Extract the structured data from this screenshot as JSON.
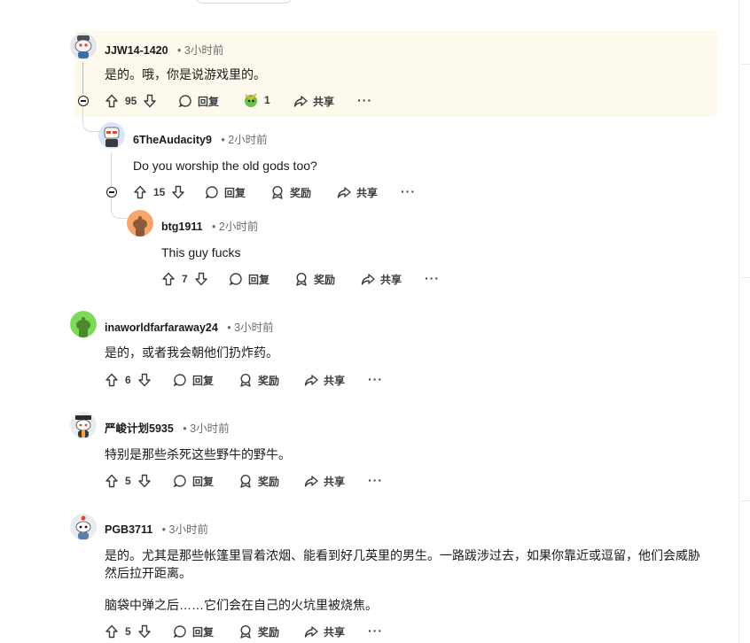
{
  "comments": [
    {
      "author": "JJW14-1420",
      "time": "• 3小时前",
      "text": "是的。哦，你是说游戏里的。",
      "votes": "95",
      "reply_label": "回复",
      "award_count": "1",
      "share_label": "共享",
      "more_label": "···"
    },
    {
      "author": "6TheAudacity9",
      "time": "• 2小时前",
      "text": "Do you worship the old gods too?",
      "votes": "15",
      "reply_label": "回复",
      "award_label": "奖励",
      "share_label": "共享",
      "more_label": "···"
    },
    {
      "author": "btg1911",
      "time": "• 2小时前",
      "text": "This guy fucks",
      "votes": "7",
      "reply_label": "回复",
      "award_label": "奖励",
      "share_label": "共享",
      "more_label": "···"
    },
    {
      "author": "inaworldfarfaraway24",
      "time": "• 3小时前",
      "text": "是的，或者我会朝他们扔炸药。",
      "votes": "6",
      "reply_label": "回复",
      "award_label": "奖励",
      "share_label": "共享",
      "more_label": "···"
    },
    {
      "author": "严峻计划5935",
      "time": "• 3小时前",
      "text": "特别是那些杀死这些野牛的野牛。",
      "votes": "5",
      "reply_label": "回复",
      "award_label": "奖励",
      "share_label": "共享",
      "more_label": "···"
    },
    {
      "author": "PGB3711",
      "time": "• 3小时前",
      "text_line1": "是的。尤其是那些帐篷里冒着浓烟、能看到好几英里的男生。一路跋涉过去，如果你靠近或逗留，他们会威胁",
      "text_line2": "然后拉开距离。",
      "text_line3": "脑袋中弹之后……它们会在自己的火坑里被烧焦。",
      "votes": "5",
      "reply_label": "回复",
      "award_label": "奖励",
      "share_label": "共享",
      "more_label": "···"
    }
  ],
  "colors": {
    "highlight_bg": "#fdf9ec",
    "text": "#1a1a1b",
    "meta": "#6a6e71",
    "thread_line": "#d7dadc"
  },
  "icons": [
    "upvote-icon",
    "downvote-icon",
    "comment-icon",
    "award-icon",
    "share-icon",
    "collapse-icon",
    "gold-award-icon"
  ]
}
